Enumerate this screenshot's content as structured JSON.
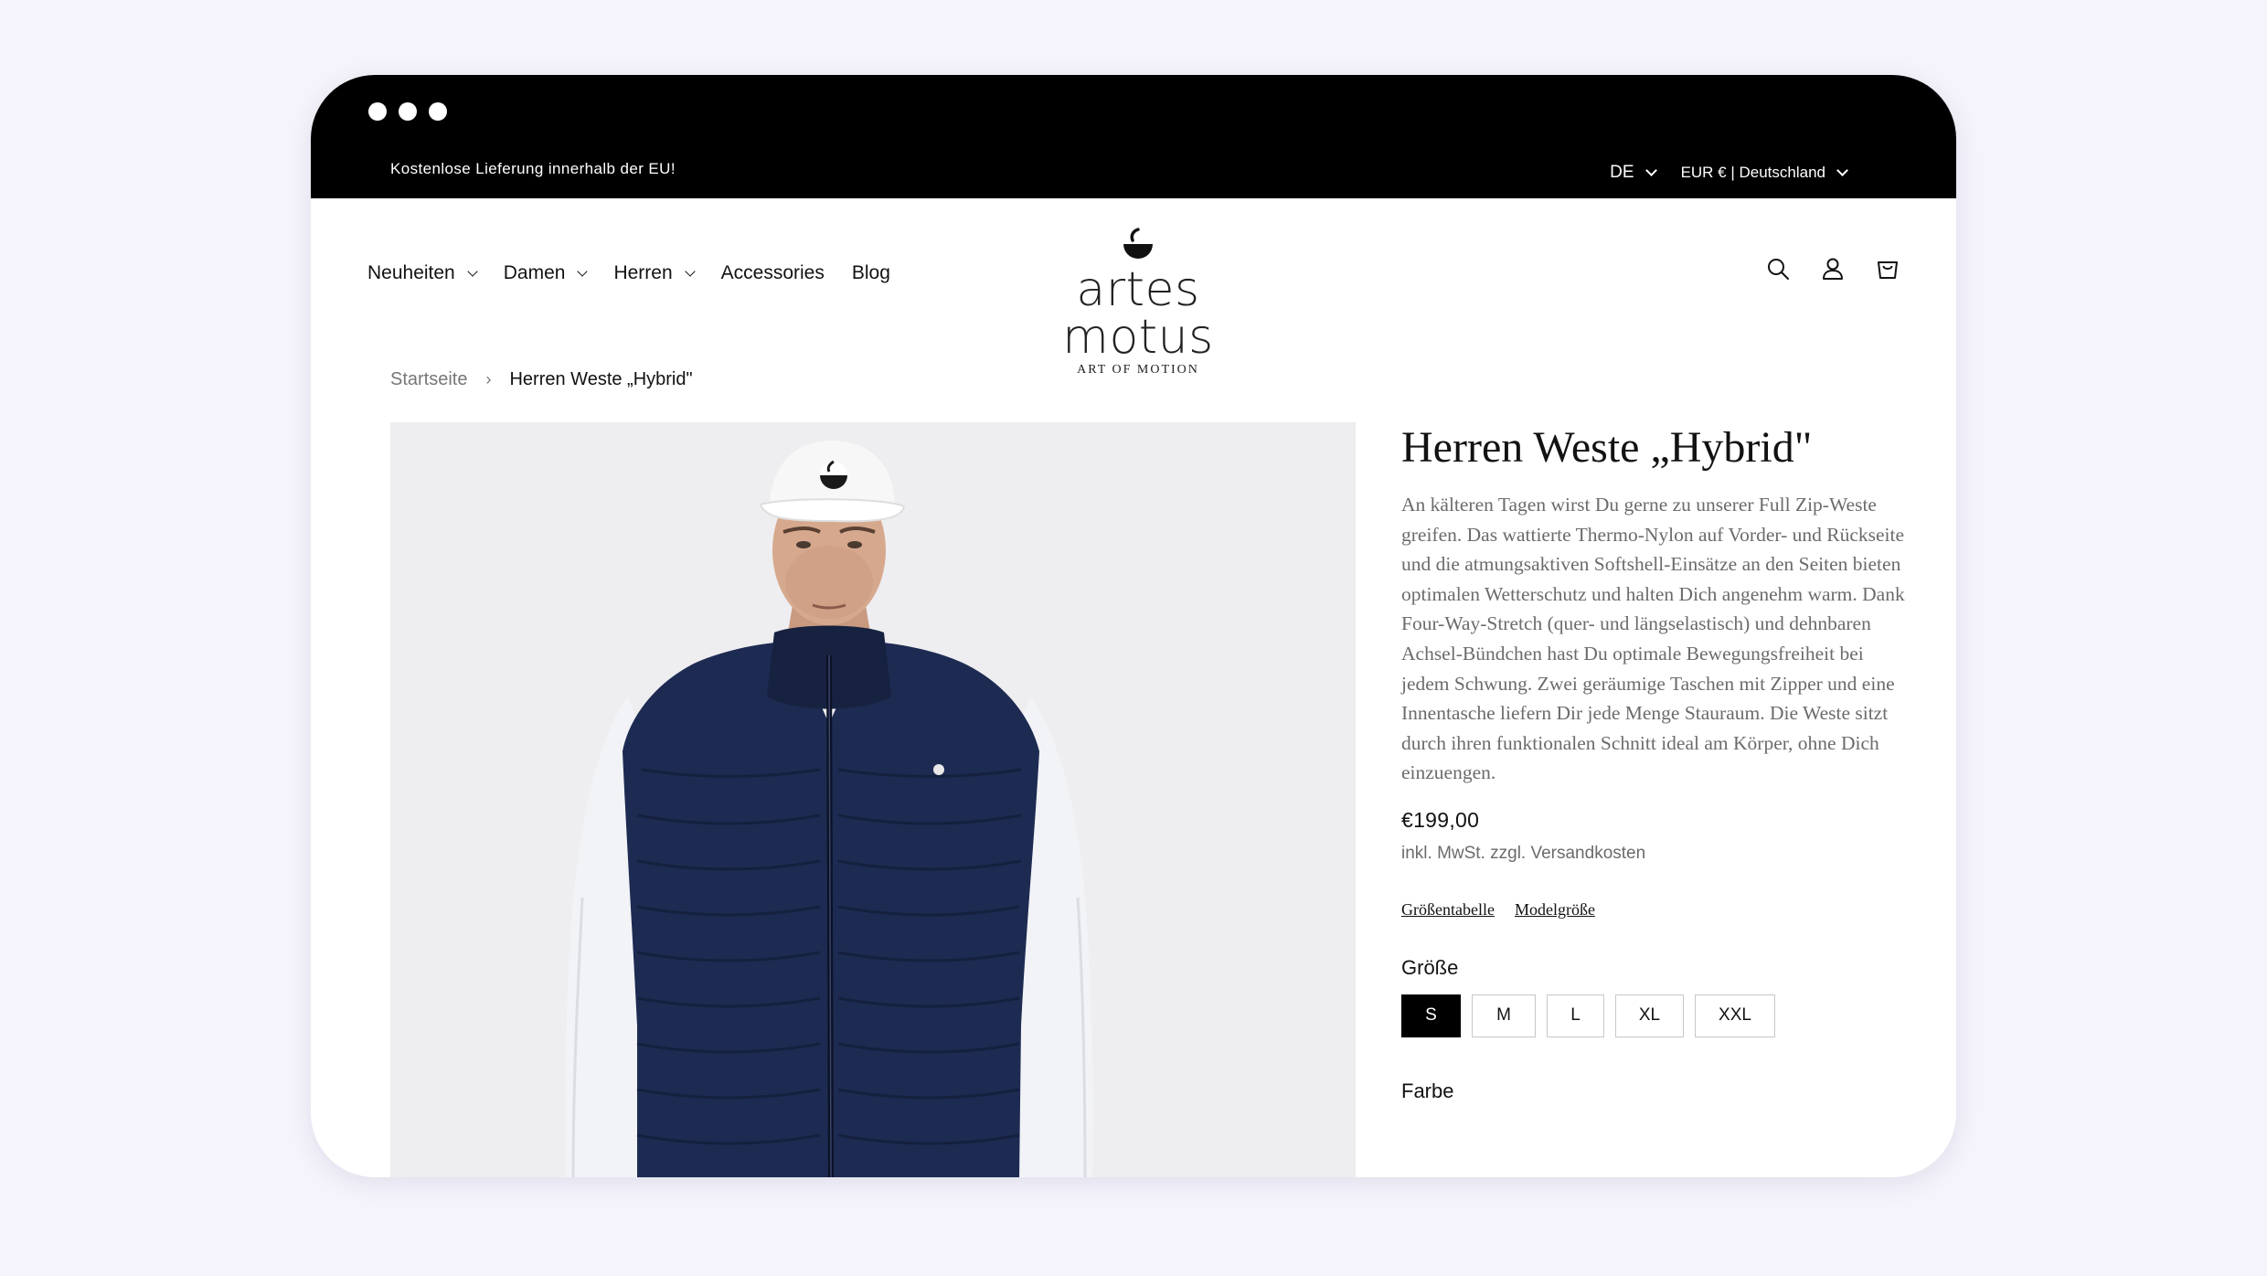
{
  "announcement": "Kostenlose Lieferung innerhalb der EU!",
  "locale": {
    "language": "DE",
    "currency_country": "EUR € | Deutschland"
  },
  "nav": [
    {
      "label": "Neuheiten",
      "has_dropdown": true
    },
    {
      "label": "Damen",
      "has_dropdown": true
    },
    {
      "label": "Herren",
      "has_dropdown": true
    },
    {
      "label": "Accessories",
      "has_dropdown": false
    },
    {
      "label": "Blog",
      "has_dropdown": false
    }
  ],
  "logo": {
    "wordmark": "artes motus",
    "tagline": "ART OF MOTION"
  },
  "header_icons": [
    "search-icon",
    "account-icon",
    "cart-icon"
  ],
  "breadcrumb": {
    "home": "Startseite",
    "current": "Herren Weste „Hybrid\""
  },
  "product": {
    "title": "Herren Weste „Hybrid\"",
    "description": "An kälteren Tagen wirst Du gerne zu unserer Full Zip-Weste greifen. Das wattierte Thermo-Nylon auf Vorder- und Rückseite und die atmungsaktiven Softshell-Einsätze an den Seiten bieten optimalen Wetterschutz und halten Dich angenehm warm. Dank Four-Way-Stretch (quer- und längselastisch) und dehnbaren Achsel-Bündchen hast Du optimale Bewegungsfreiheit bei jedem Schwung. Zwei geräumige Taschen mit Zipper und eine Innentasche liefern Dir jede Menge Stauraum. Die Weste sitzt durch ihren funktionalen Schnitt ideal am Körper, ohne Dich einzuengen.",
    "price": "€199,00",
    "tax_note": "inkl. MwSt. zzgl. Versandkosten",
    "links": {
      "size_chart": "Größentabelle",
      "model_size": "Modelgröße"
    },
    "size_label": "Größe",
    "sizes": [
      "S",
      "M",
      "L",
      "XL",
      "XXL"
    ],
    "selected_size": "S",
    "color_label": "Farbe"
  },
  "colors": {
    "vest": "#1d2b52",
    "shirt": "#f2f3f7",
    "cap": "#f7f7f7",
    "image_bg": "#eeedf0",
    "accent": "#000000"
  }
}
